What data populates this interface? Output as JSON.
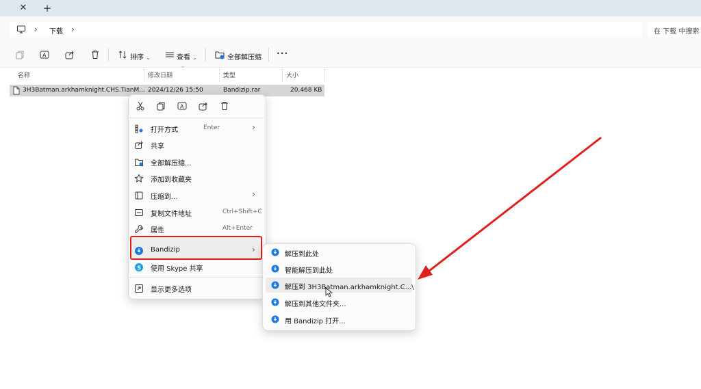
{
  "tabbar": {
    "close_glyph": "✕",
    "new_tab_glyph": "+"
  },
  "address": {
    "root_icon": "pc-icon",
    "separator": "›",
    "crumbs": [
      "下载"
    ],
    "search_placeholder": "在 下载 中搜索"
  },
  "toolbar": {
    "icons": [
      "new-copy-icon",
      "rename-icon",
      "share-icon",
      "delete-icon"
    ],
    "sort_label": "排序",
    "view_label": "查看",
    "extract_all_label": "全部解压缩",
    "more_glyph": "•••"
  },
  "columns": {
    "name": "名称",
    "modified": "修改日期",
    "type": "类型",
    "size": "大小"
  },
  "file": {
    "name": "3H3Batman.arkhamknight.CHS.TianM...",
    "modified": "2024/12/26 15:50",
    "type": "Bandizip.rar",
    "size": "20,468 KB"
  },
  "context_menu": {
    "quick_actions": [
      "cut-icon",
      "copy-icon",
      "rename-icon",
      "share-icon",
      "delete-icon"
    ],
    "open_with": {
      "label": "打开方式",
      "shortcut": "Enter"
    },
    "share": {
      "label": "共享"
    },
    "extract_all": {
      "label": "全部解压缩..."
    },
    "add_favorites": {
      "label": "添加到收藏夹"
    },
    "compress_to": {
      "label": "压缩到..."
    },
    "copy_path": {
      "label": "复制文件地址",
      "shortcut": "Ctrl+Shift+C"
    },
    "properties": {
      "label": "属性",
      "shortcut": "Alt+Enter"
    },
    "bandizip": {
      "label": "Bandizip"
    },
    "skype": {
      "label": "使用 Skype 共享"
    },
    "more_options": {
      "label": "显示更多选项"
    },
    "arrow_glyph": "›"
  },
  "submenu": {
    "items": [
      "解压到此处",
      "智能解压到此处",
      "解压到 3H3Batman.arkhamknight.C...\\",
      "解压到其他文件夹...",
      "用 Bandizip 打开..."
    ]
  },
  "colors": {
    "highlight_border": "#e0201c",
    "annotation_arrow": "#e0201c",
    "bandizip_blue": "#1f7ae0",
    "selected_row": "#d6d6d6"
  }
}
